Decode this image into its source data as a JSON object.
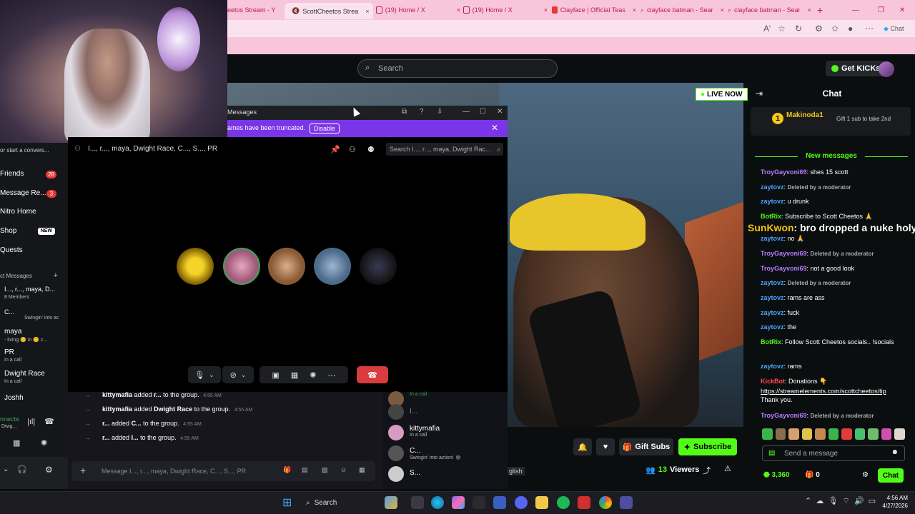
{
  "browser": {
    "tabs": [
      {
        "label": "eetos Stream - Y",
        "color": "#c2185b"
      },
      {
        "label": "ScottCheetos Strea",
        "color": "#53fc18",
        "active": true
      },
      {
        "label": "(19) Home / X",
        "color": "#c2185b"
      },
      {
        "label": "(19) Home / X",
        "color": "#c2185b"
      },
      {
        "label": "Clayface | Official Teas",
        "color": "#c2185b"
      },
      {
        "label": "clayface batman - Sear",
        "color": "#c2185b"
      },
      {
        "label": "clayface batman - Sear",
        "color": "#c2185b"
      }
    ],
    "toolbar_chat": "Chat"
  },
  "kick": {
    "search_placeholder": "Search",
    "get_kicks": "Get KICKs",
    "live": "LIVE NOW",
    "gift_subs": "Gift Subs",
    "subscribe": "Subscribe",
    "viewers_count": "13",
    "viewers_label": "Viewers",
    "caption": "glish"
  },
  "chat": {
    "title": "Chat",
    "pinned_name": "Makinoda1",
    "pinned_level": "1",
    "pinned_gift": "Gift 1 sub to take 2nd",
    "new_messages": "New messages",
    "overlay_user": "SunKwon",
    "overlay_text": ": bro dropped a nuke holy",
    "messages": [
      {
        "user": "TroyGayvoni69",
        "color": "#b57cff",
        "text": ": shes 15 scott"
      },
      {
        "user": "zaytovz",
        "color": "#4ca3ff",
        "deleted": "Deleted by a moderator"
      },
      {
        "user": "zaytovz",
        "color": "#4ca3ff",
        "text": ": u drunk"
      },
      {
        "user": "BotRix",
        "color": "#53fc18",
        "text": ": Subscribe to Scott Cheetos 🙏"
      },
      {
        "user": "zaytovz",
        "color": "#4ca3ff",
        "text": ": no 🙏"
      },
      {
        "user": "TroyGayvoni69",
        "color": "#b57cff",
        "deleted": "Deleted by a moderator"
      },
      {
        "user": "TroyGayvoni69",
        "color": "#b57cff",
        "text": ": not a good look"
      },
      {
        "user": "zaytovz",
        "color": "#4ca3ff",
        "deleted": "Deleted by a moderator"
      },
      {
        "user": "zaytovz",
        "color": "#4ca3ff",
        "text": ": rams are ass"
      },
      {
        "user": "zaytovz",
        "color": "#4ca3ff",
        "text": ": fuck"
      },
      {
        "user": "zaytovz",
        "color": "#4ca3ff",
        "text": ": the"
      },
      {
        "user": "BotRix",
        "color": "#53fc18",
        "text": ": Follow Scott Cheetos socials.. !socials"
      },
      {
        "user": "zaytovz",
        "color": "#4ca3ff",
        "text": ": rams"
      },
      {
        "user": "KickBot",
        "color": "#ff4d4d",
        "text": ": Donations 👇"
      },
      {
        "link": "https://streamelements.com/scottcheetos/tip",
        "text": "Thank you."
      },
      {
        "user": "TroyGayvoni69",
        "color": "#b57cff",
        "deleted": "Deleted by a moderator"
      }
    ],
    "send_placeholder": "Send a message",
    "points": "3,360",
    "gifts": "0",
    "chat_button": "Chat"
  },
  "discord": {
    "sidebar_top": "or start a convers...",
    "nav": [
      {
        "label": "Friends",
        "badge": "28"
      },
      {
        "label": "Message Re...",
        "badge": "3"
      },
      {
        "label": "Nitro Home"
      },
      {
        "label": "Shop",
        "tag": "NEW"
      },
      {
        "label": "Quests"
      }
    ],
    "dm_header": "ct Messages",
    "dms": [
      {
        "label": "I..., r..., maya, D...",
        "sub": "8 Members"
      },
      {
        "label": "C...",
        "sub": "Swingin' into ac"
      },
      {
        "label": "maya",
        "sub": "- living 😊 in 😊 c..."
      },
      {
        "label": "PR",
        "sub": "In a call"
      },
      {
        "label": "Dwight Race",
        "sub": "In a call"
      },
      {
        "label": "Joshh",
        "sub": ""
      }
    ],
    "footer_label": "nnecte",
    "footer_sub": "Dwig...",
    "window_title": "Messages",
    "notice_text": "ames have been truncated.",
    "notice_button": "Disable",
    "group_name": "I..., r..., maya, Dwight Race, C..., S..., PR",
    "call_search": "Search I..., r..., maya, Dwight Rac...",
    "system_msgs": [
      {
        "actor": "kittymafia",
        "verb": "added",
        "target": "r...",
        "rest": "to the group.",
        "time": "4:55 AM"
      },
      {
        "actor": "kittymafia",
        "verb": "added",
        "target": "Dwight Race",
        "rest": "to the group.",
        "time": "4:55 AM"
      },
      {
        "actor": "r...",
        "verb": "added",
        "target": "C...",
        "rest": "to the group.",
        "time": "4:55 AM"
      },
      {
        "actor": "r...",
        "verb": "added",
        "target": "I...",
        "rest": "to the group.",
        "time": "4:55 AM"
      }
    ],
    "members": [
      {
        "name": "",
        "sub": "In a call"
      },
      {
        "name": "I...",
        "sub": ""
      },
      {
        "name": "kittymafia",
        "sub": "In a call"
      },
      {
        "name": "C...",
        "sub": "Swingin' into action! 🕸"
      },
      {
        "name": "S...",
        "sub": ""
      }
    ],
    "input_placeholder": "Message I..., r..., maya, Dwight Race, C..., S..., PR"
  },
  "taskbar": {
    "search": "Search",
    "time": "4:56 AM",
    "date": "4/27/2026"
  }
}
